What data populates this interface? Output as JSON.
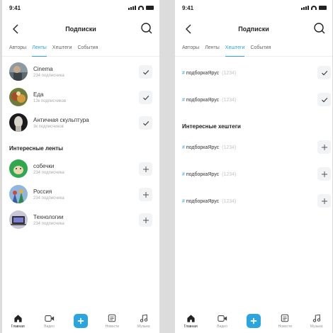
{
  "colors": {
    "accent": "#2aa5e0",
    "text": "#222222",
    "muted": "#aaaaaa"
  },
  "left": {
    "time": "9:41",
    "title": "Подписки",
    "tabs": [
      {
        "label": "Авторы",
        "active": false
      },
      {
        "label": "Ленты",
        "active": true
      },
      {
        "label": "Хештеги",
        "active": false
      },
      {
        "label": "События",
        "active": false
      }
    ],
    "subscribed": [
      {
        "title": "Cinema",
        "sub": "234 подписчика",
        "action": "check-icon"
      },
      {
        "title": "Еда",
        "sub": "13к подписчиков",
        "action": "check-icon"
      },
      {
        "title": "Античная скульптура",
        "sub": "3к подписчиков",
        "action": "check-icon"
      }
    ],
    "interesting_title": "Интересные ленты",
    "interesting": [
      {
        "title": "собечки",
        "sub": "234 подписчика",
        "action": "plus-icon"
      },
      {
        "title": "Россия",
        "sub": "234 подписчика",
        "action": "plus-icon"
      },
      {
        "title": "Технологии",
        "sub": "234 подписчика",
        "action": "plus-icon"
      }
    ]
  },
  "right": {
    "time": "9:41",
    "title": "Подписки",
    "tabs": [
      {
        "label": "Авторы",
        "active": false
      },
      {
        "label": "Ленты",
        "active": false
      },
      {
        "label": "Хештеги",
        "active": true
      },
      {
        "label": "События",
        "active": false
      }
    ],
    "subscribed": [
      {
        "hash": "#",
        "tag": "подборкаЯрус",
        "count": "(1234)",
        "action": "check-icon"
      },
      {
        "hash": "#",
        "tag": "подборкаЯрус",
        "count": "(1234)",
        "action": "check-icon"
      }
    ],
    "interesting_title": "Интересные хештеги",
    "interesting": [
      {
        "hash": "#",
        "tag": "подборкаЯрус",
        "count": "(1234)",
        "action": "plus-icon"
      },
      {
        "hash": "#",
        "tag": "подборкаЯрус",
        "count": "(1234)",
        "action": "plus-icon"
      },
      {
        "hash": "#",
        "tag": "подборкаЯрус",
        "count": "(1234)",
        "action": "plus-icon"
      }
    ]
  },
  "nav": [
    {
      "label": "Главная",
      "icon": "home-icon",
      "active": true
    },
    {
      "label": "Видео",
      "icon": "video-icon",
      "active": false
    },
    {
      "label": "",
      "icon": "plus-icon",
      "active": false
    },
    {
      "label": "Новости",
      "icon": "news-icon",
      "active": false
    },
    {
      "label": "Музыка",
      "icon": "music-icon",
      "active": false
    }
  ]
}
